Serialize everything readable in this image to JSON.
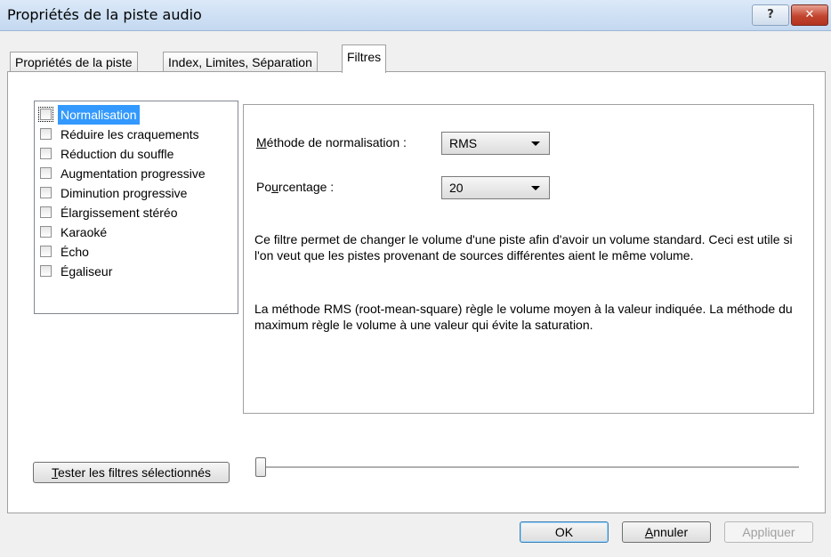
{
  "window": {
    "title": "Propriétés de la piste audio",
    "help_label": "?",
    "close_label": "✕"
  },
  "tabs": [
    {
      "label": "Propriétés de la piste",
      "active": false
    },
    {
      "label": "Index, Limites, Séparation",
      "active": false
    },
    {
      "label": "Filtres",
      "active": true
    }
  ],
  "filters": [
    {
      "label": "Normalisation",
      "checked": false,
      "selected": true
    },
    {
      "label": "Réduire les craquements",
      "checked": false,
      "selected": false
    },
    {
      "label": "Réduction du souffle",
      "checked": false,
      "selected": false
    },
    {
      "label": "Augmentation progressive",
      "checked": false,
      "selected": false
    },
    {
      "label": "Diminution progressive",
      "checked": false,
      "selected": false
    },
    {
      "label": "Élargissement stéréo",
      "checked": false,
      "selected": false
    },
    {
      "label": "Karaoké",
      "checked": false,
      "selected": false
    },
    {
      "label": "Écho",
      "checked": false,
      "selected": false
    },
    {
      "label": "Égaliseur",
      "checked": false,
      "selected": false
    }
  ],
  "settings": {
    "method_label_first": "M",
    "method_label_rest": "éthode de normalisation :",
    "method_value": "RMS",
    "percent_label_pre": "Po",
    "percent_label_u": "u",
    "percent_label_post": "rcentage :",
    "percent_value": "20",
    "description_1": "Ce filtre permet de changer le volume d'une piste afin d'avoir un volume standard. Ceci est utile si l'on veut que les pistes provenant de sources différentes aient le même volume.",
    "description_2": "La méthode RMS (root-mean-square) règle le volume moyen à la valeur indiquée. La méthode du maximum règle le volume à une valeur qui évite la saturation."
  },
  "test_button": {
    "label_first": "T",
    "label_rest": "ester les filtres sélectionnés"
  },
  "preview_slider": {
    "position": 0
  },
  "buttons": {
    "ok": "OK",
    "cancel_first": "A",
    "cancel_rest": "nnuler",
    "apply": "Appliquer"
  }
}
